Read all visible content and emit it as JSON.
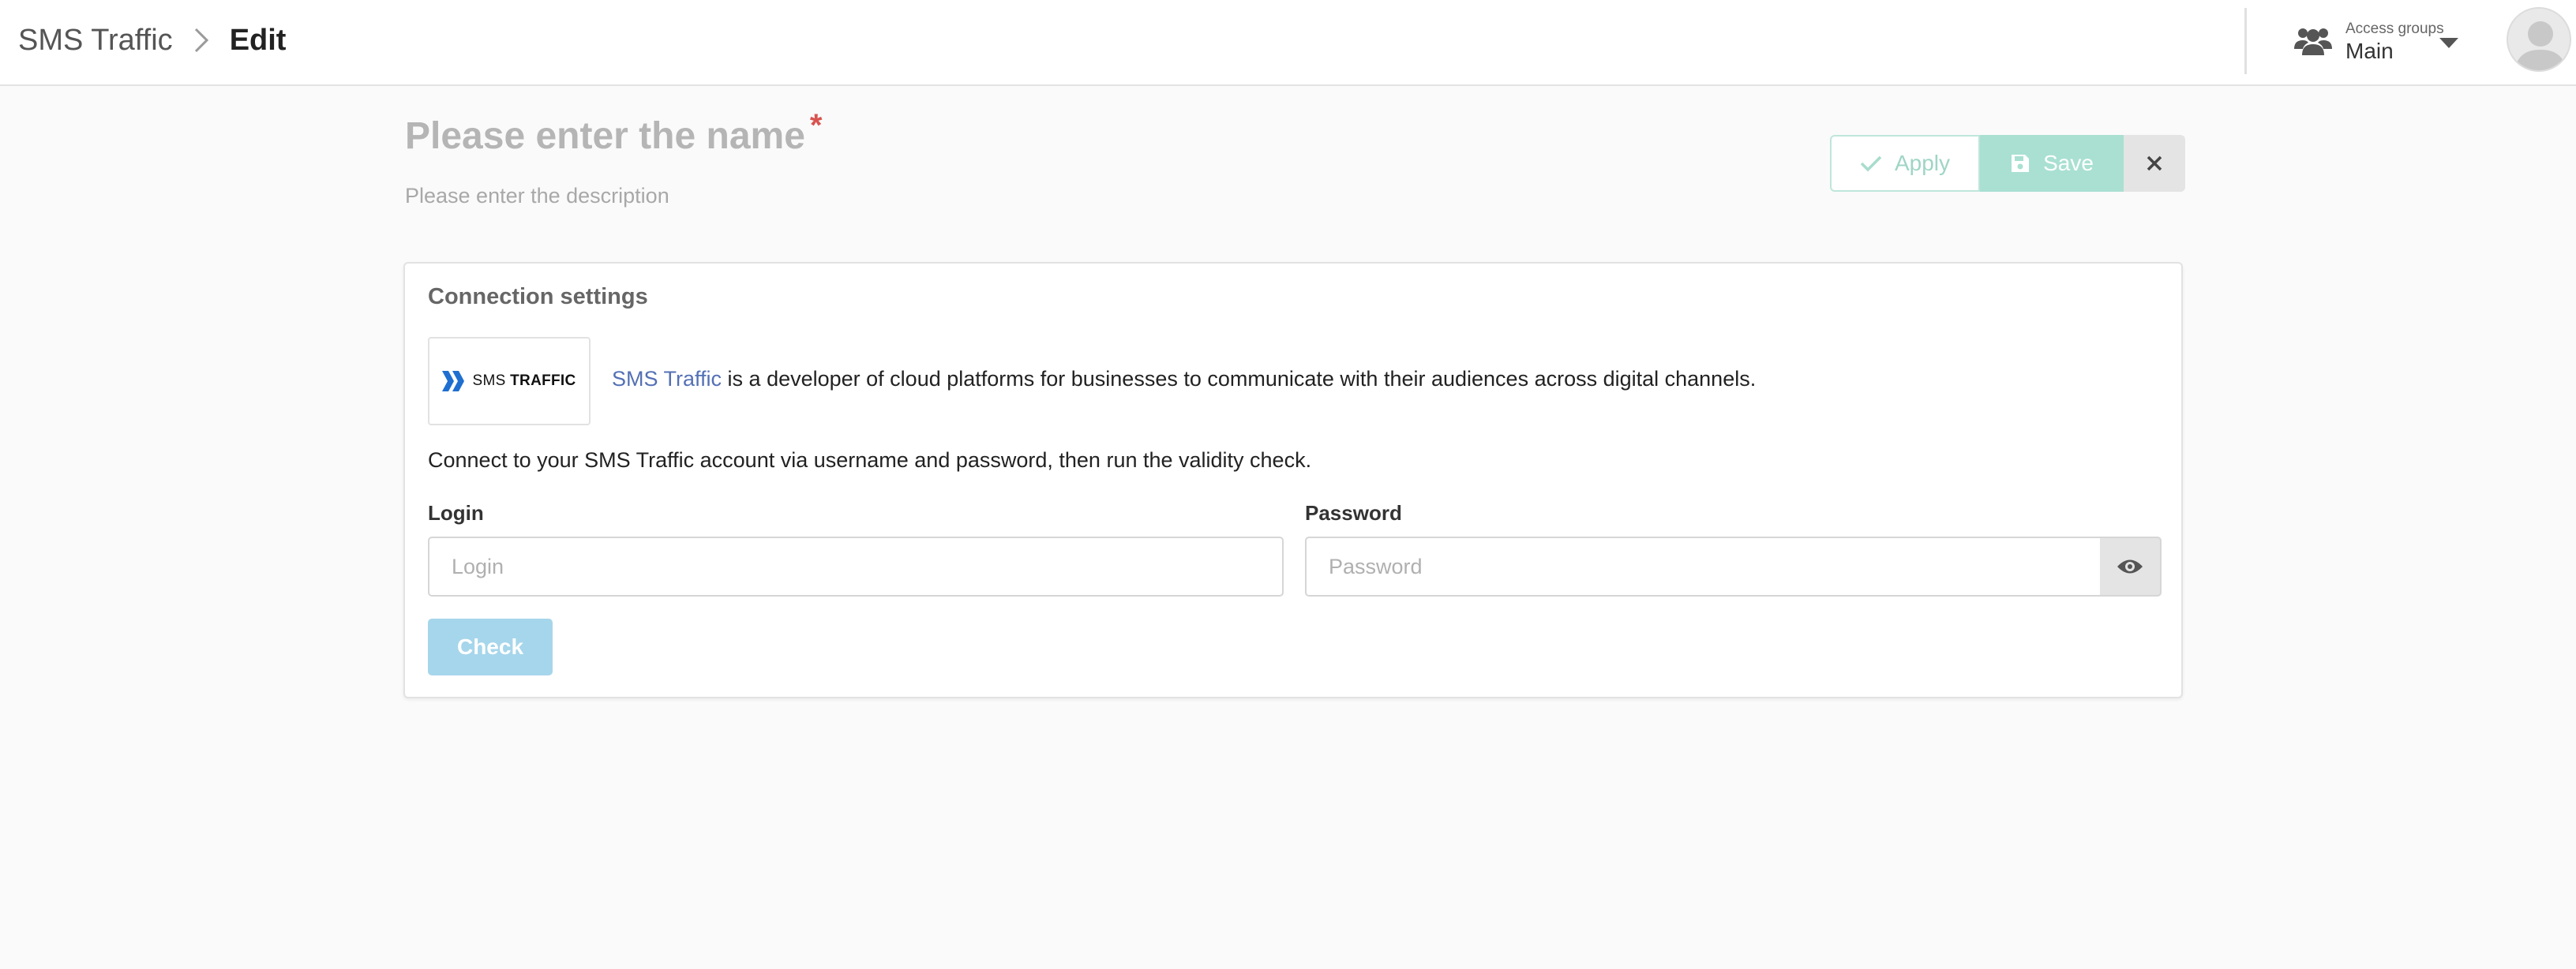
{
  "header": {
    "breadcrumb_root": "SMS Traffic",
    "breadcrumb_current": "Edit",
    "access_groups_label": "Access groups",
    "access_groups_value": "Main"
  },
  "title": {
    "name_placeholder": "Please enter the name",
    "required_mark": "*",
    "description_placeholder": "Please enter the description"
  },
  "actions": {
    "apply_label": "Apply",
    "save_label": "Save"
  },
  "connection": {
    "section_title": "Connection settings",
    "logo_text_light": "SMS ",
    "logo_text_bold": "TRAFFIC",
    "intro_link": "SMS Traffic",
    "intro_rest": " is a developer of cloud platforms for businesses to communicate with their audiences across digital channels.",
    "connect_text": "Connect to your SMS Traffic account via username and password, then run the validity check.",
    "login_label": "Login",
    "login_placeholder": "Login",
    "login_value": "",
    "password_label": "Password",
    "password_placeholder": "Password",
    "password_value": "",
    "check_label": "Check"
  },
  "colors": {
    "accent_teal": "#a9e0d2",
    "check_blue": "#a6d6eb",
    "link_blue": "#5470b5",
    "required_red": "#d9534f"
  },
  "icons": [
    "chevron-right-icon",
    "users-icon",
    "caret-down-icon",
    "avatar",
    "check-icon",
    "save-icon",
    "close-icon",
    "sms-traffic-logo",
    "eye-icon"
  ]
}
